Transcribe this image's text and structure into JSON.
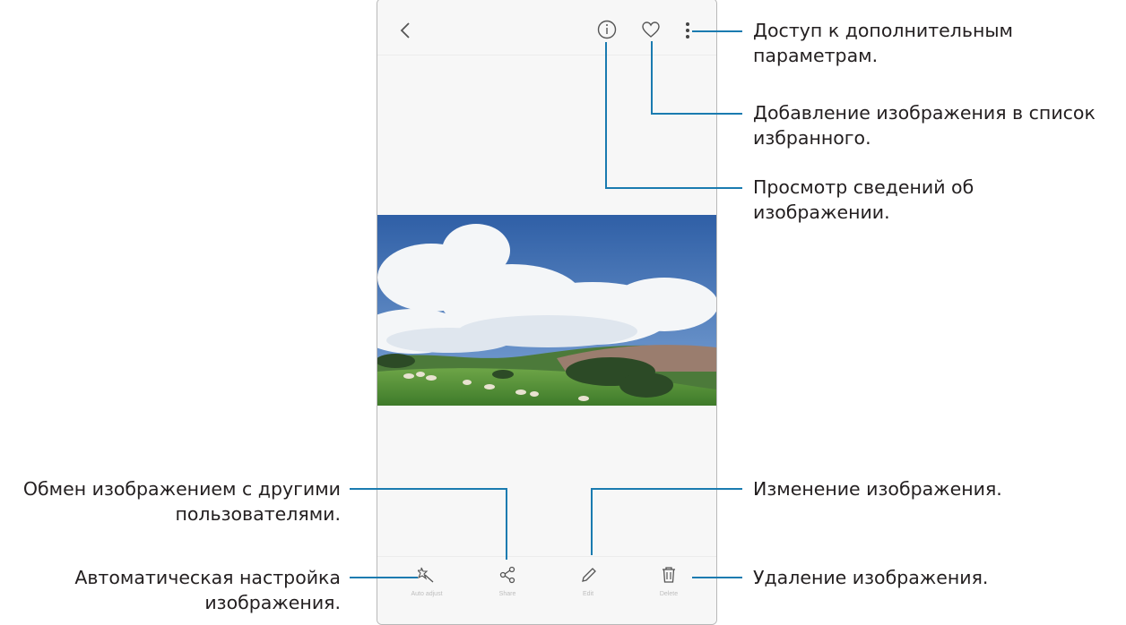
{
  "phone": {
    "bottom_actions": [
      {
        "label": "Auto adjust",
        "icon": "magic-wand-icon"
      },
      {
        "label": "Share",
        "icon": "share-icon"
      },
      {
        "label": "Edit",
        "icon": "pencil-icon"
      },
      {
        "label": "Delete",
        "icon": "trash-icon"
      }
    ]
  },
  "callouts": {
    "more_options": {
      "line1": "Доступ к дополнительным",
      "line2": "параметрам."
    },
    "favorite": {
      "line1": "Добавление изображения в список",
      "line2": "избранного."
    },
    "details": {
      "line1": "Просмотр сведений об",
      "line2": "изображении."
    },
    "share": {
      "line1": "Обмен изображением с другими",
      "line2": "пользователями."
    },
    "auto_adjust": {
      "line1": "Автоматическая настройка",
      "line2": "изображения."
    },
    "edit": {
      "line1": "Изменение изображения."
    },
    "delete": {
      "line1": "Удаление изображения."
    }
  },
  "colors": {
    "leader_line": "#1a7bb0",
    "text": "#231f20"
  }
}
